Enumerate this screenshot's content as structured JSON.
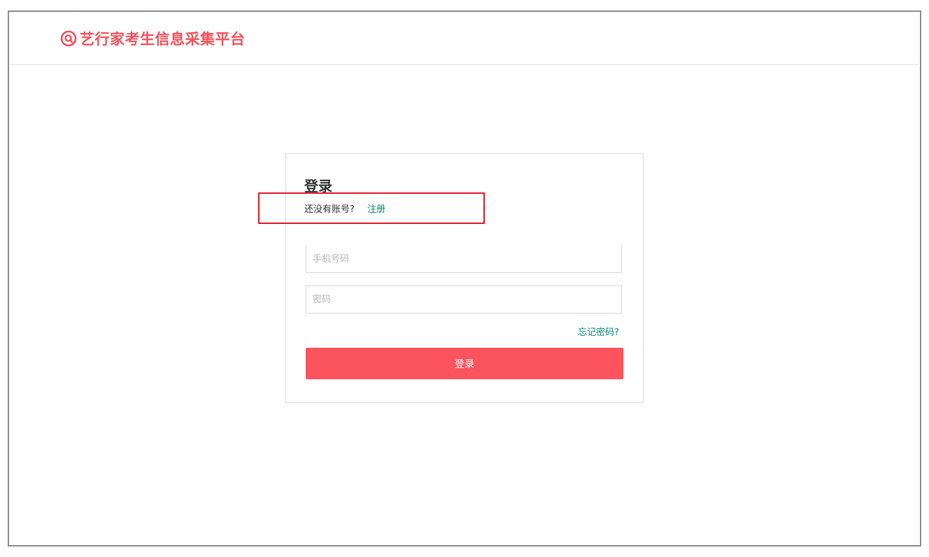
{
  "header": {
    "app_title": "艺行家考生信息采集平台",
    "logo_icon": "at-sign-icon",
    "accent_color": "#f5525c"
  },
  "login": {
    "title": "登录",
    "no_account_text": "还没有账号?",
    "register_link": "注册",
    "phone_placeholder": "手机号码",
    "password_placeholder": "密码",
    "forgot_password": "忘记密码?",
    "submit_label": "登录",
    "button_color": "#fb545e",
    "link_color": "#0a8a74"
  }
}
